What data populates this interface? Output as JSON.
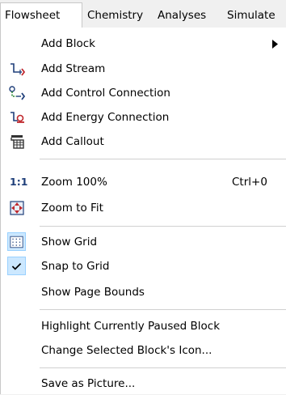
{
  "menubar": {
    "tabs": [
      {
        "label": "Flowsheet",
        "active": true
      },
      {
        "label": "Chemistry"
      },
      {
        "label": "Analyses"
      },
      {
        "label": "Simulate"
      }
    ]
  },
  "menu": {
    "items": [
      {
        "label": "Add Block",
        "icon": "none",
        "submenu": true
      },
      {
        "label": "Add Stream",
        "icon": "stream-icon"
      },
      {
        "label": "Add Control Connection",
        "icon": "control-connection-icon"
      },
      {
        "label": "Add Energy Connection",
        "icon": "energy-connection-icon"
      },
      {
        "label": "Add Callout",
        "icon": "callout-icon"
      },
      {
        "label": "Zoom 100%",
        "icon": "zoom-100-icon",
        "icon_text": "1:1",
        "shortcut": "Ctrl+0"
      },
      {
        "label": "Zoom to Fit",
        "icon": "zoom-to-fit-icon"
      },
      {
        "label": "Show Grid",
        "icon": "grid-icon",
        "checked": true
      },
      {
        "label": "Snap to Grid",
        "icon": "checkmark-icon",
        "checked": true
      },
      {
        "label": "Show Page Bounds",
        "icon": "none"
      },
      {
        "label": "Highlight Currently Paused Block",
        "icon": "none"
      },
      {
        "label": "Change Selected Block's Icon...",
        "icon": "none"
      },
      {
        "label": "Save as Picture...",
        "icon": "none"
      }
    ]
  },
  "colors": {
    "menu_background": "#ffffff",
    "menubar_background": "#f0f0f0",
    "check_highlight": "#cce8ff",
    "accent_red": "#c0282d",
    "accent_blue": "#1f3f7a"
  }
}
